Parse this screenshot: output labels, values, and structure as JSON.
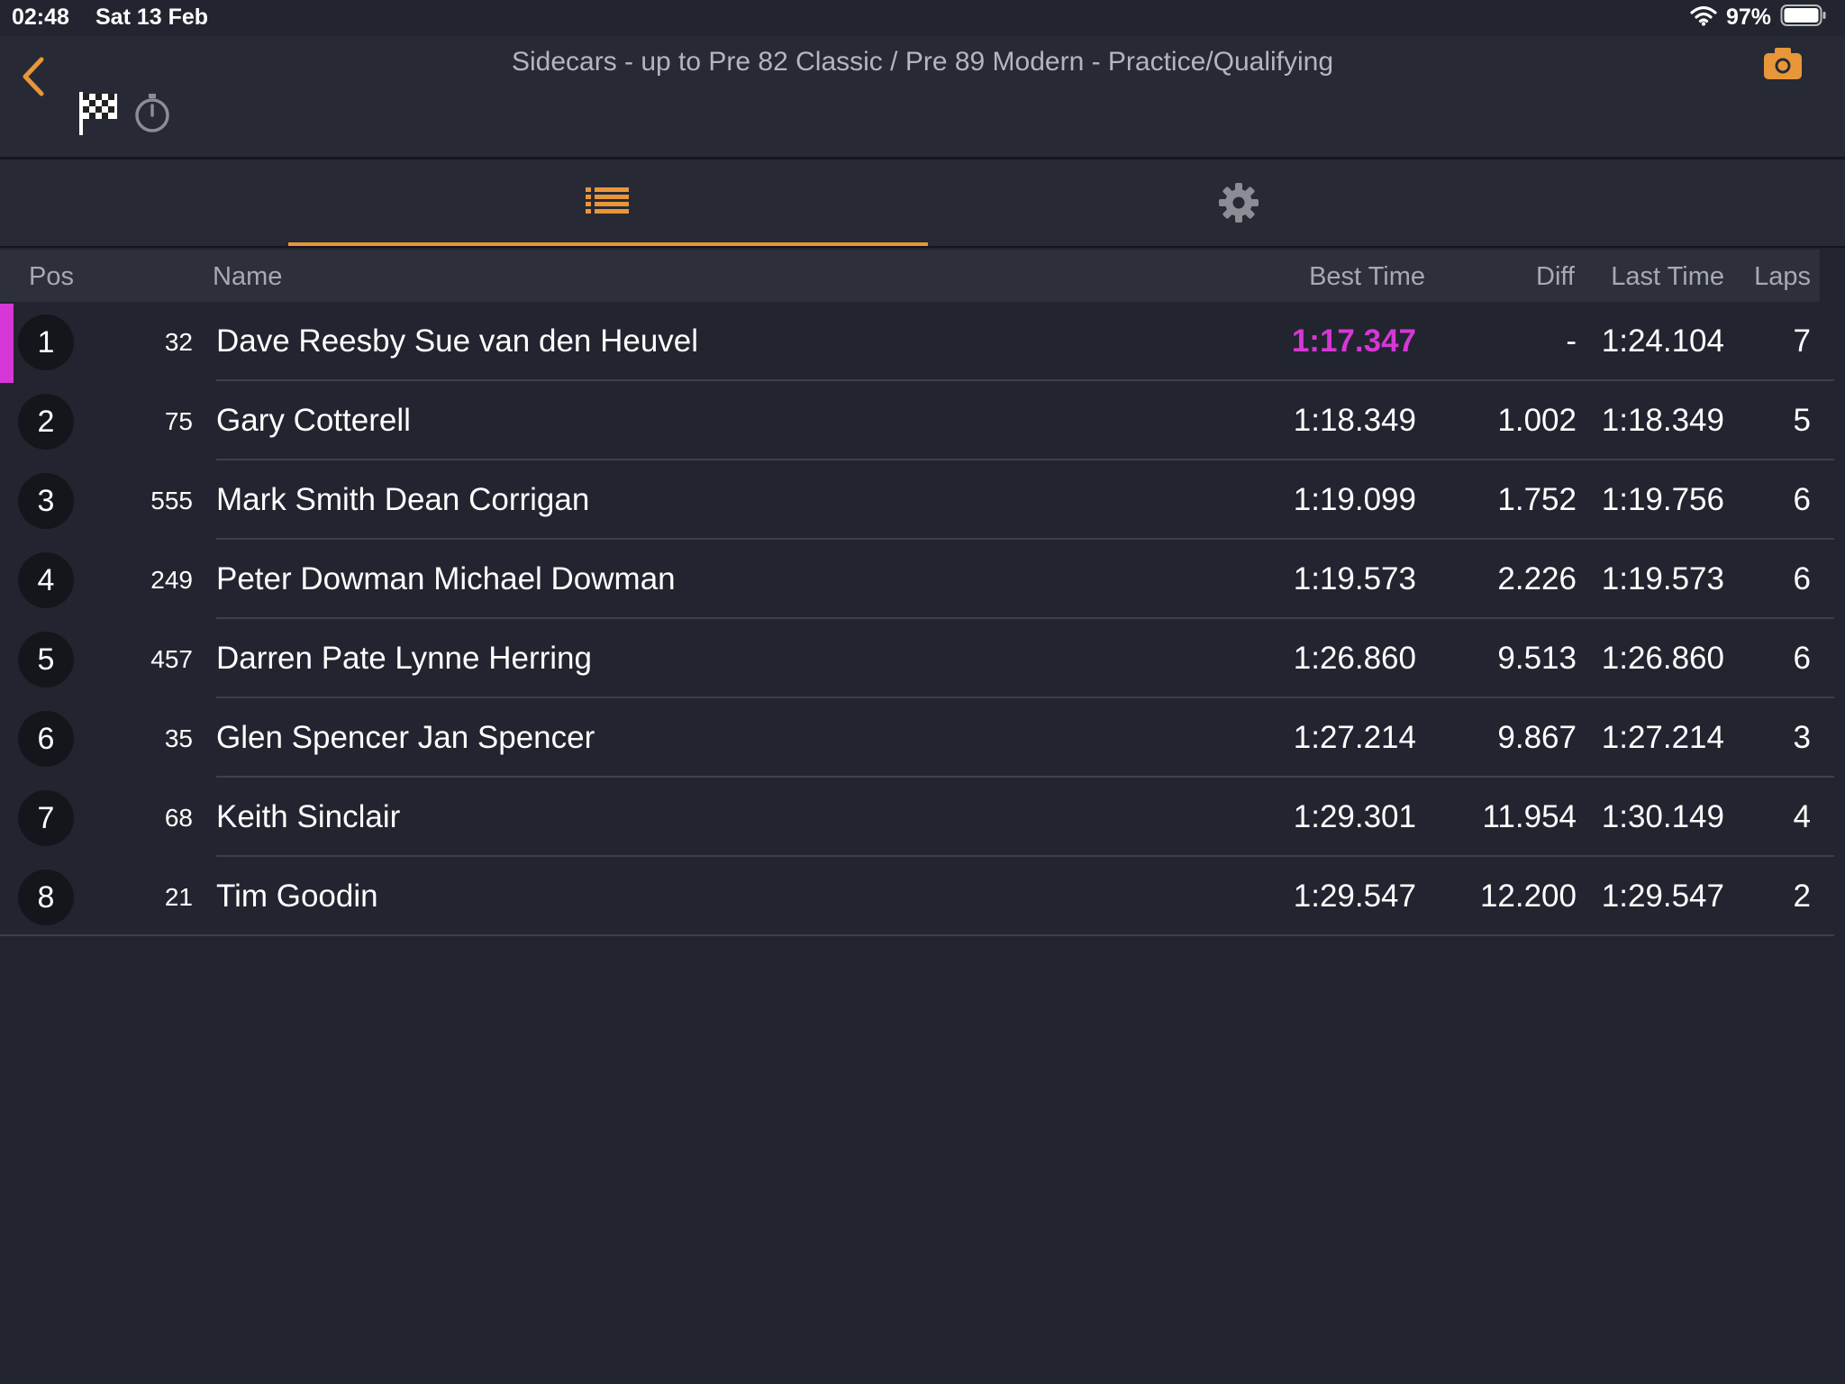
{
  "status_bar": {
    "time": "02:48",
    "date": "Sat 13 Feb",
    "battery": "97%"
  },
  "header": {
    "title": "Sidecars - up to Pre 82 Classic / Pre 89 Modern - Practice/Qualifying"
  },
  "colors": {
    "accent": "#e8963a",
    "fastest": "#d637d6",
    "background": "#22252f"
  },
  "icons": {
    "back": "chevron-left-icon",
    "camera": "camera-icon",
    "flag": "checkered-flag-icon",
    "stopwatch": "stopwatch-icon",
    "list_tab": "list-icon",
    "settings_tab": "gear-icon"
  },
  "table": {
    "columns": {
      "pos": "Pos",
      "name": "Name",
      "best": "Best Time",
      "diff": "Diff",
      "last": "Last Time",
      "laps": "Laps"
    },
    "rows": [
      {
        "pos": "1",
        "num": "32",
        "name": "Dave  Reesby Sue van den Heuvel",
        "best": "1:17.347",
        "diff": "-",
        "last": "1:24.104",
        "laps": "7"
      },
      {
        "pos": "2",
        "num": "75",
        "name": "Gary Cotterell",
        "best": "1:18.349",
        "diff": "1.002",
        "last": "1:18.349",
        "laps": "5"
      },
      {
        "pos": "3",
        "num": "555",
        "name": "Mark Smith Dean Corrigan",
        "best": "1:19.099",
        "diff": "1.752",
        "last": "1:19.756",
        "laps": "6"
      },
      {
        "pos": "4",
        "num": "249",
        "name": "Peter Dowman Michael Dowman",
        "best": "1:19.573",
        "diff": "2.226",
        "last": "1:19.573",
        "laps": "6"
      },
      {
        "pos": "5",
        "num": "457",
        "name": "Darren Pate Lynne Herring",
        "best": "1:26.860",
        "diff": "9.513",
        "last": "1:26.860",
        "laps": "6"
      },
      {
        "pos": "6",
        "num": "35",
        "name": "Glen Spencer Jan Spencer",
        "best": "1:27.214",
        "diff": "9.867",
        "last": "1:27.214",
        "laps": "3"
      },
      {
        "pos": "7",
        "num": "68",
        "name": "Keith Sinclair",
        "best": "1:29.301",
        "diff": "11.954",
        "last": "1:30.149",
        "laps": "4"
      },
      {
        "pos": "8",
        "num": "21",
        "name": "Tim Goodin",
        "best": "1:29.547",
        "diff": "12.200",
        "last": "1:29.547",
        "laps": "2"
      }
    ]
  }
}
